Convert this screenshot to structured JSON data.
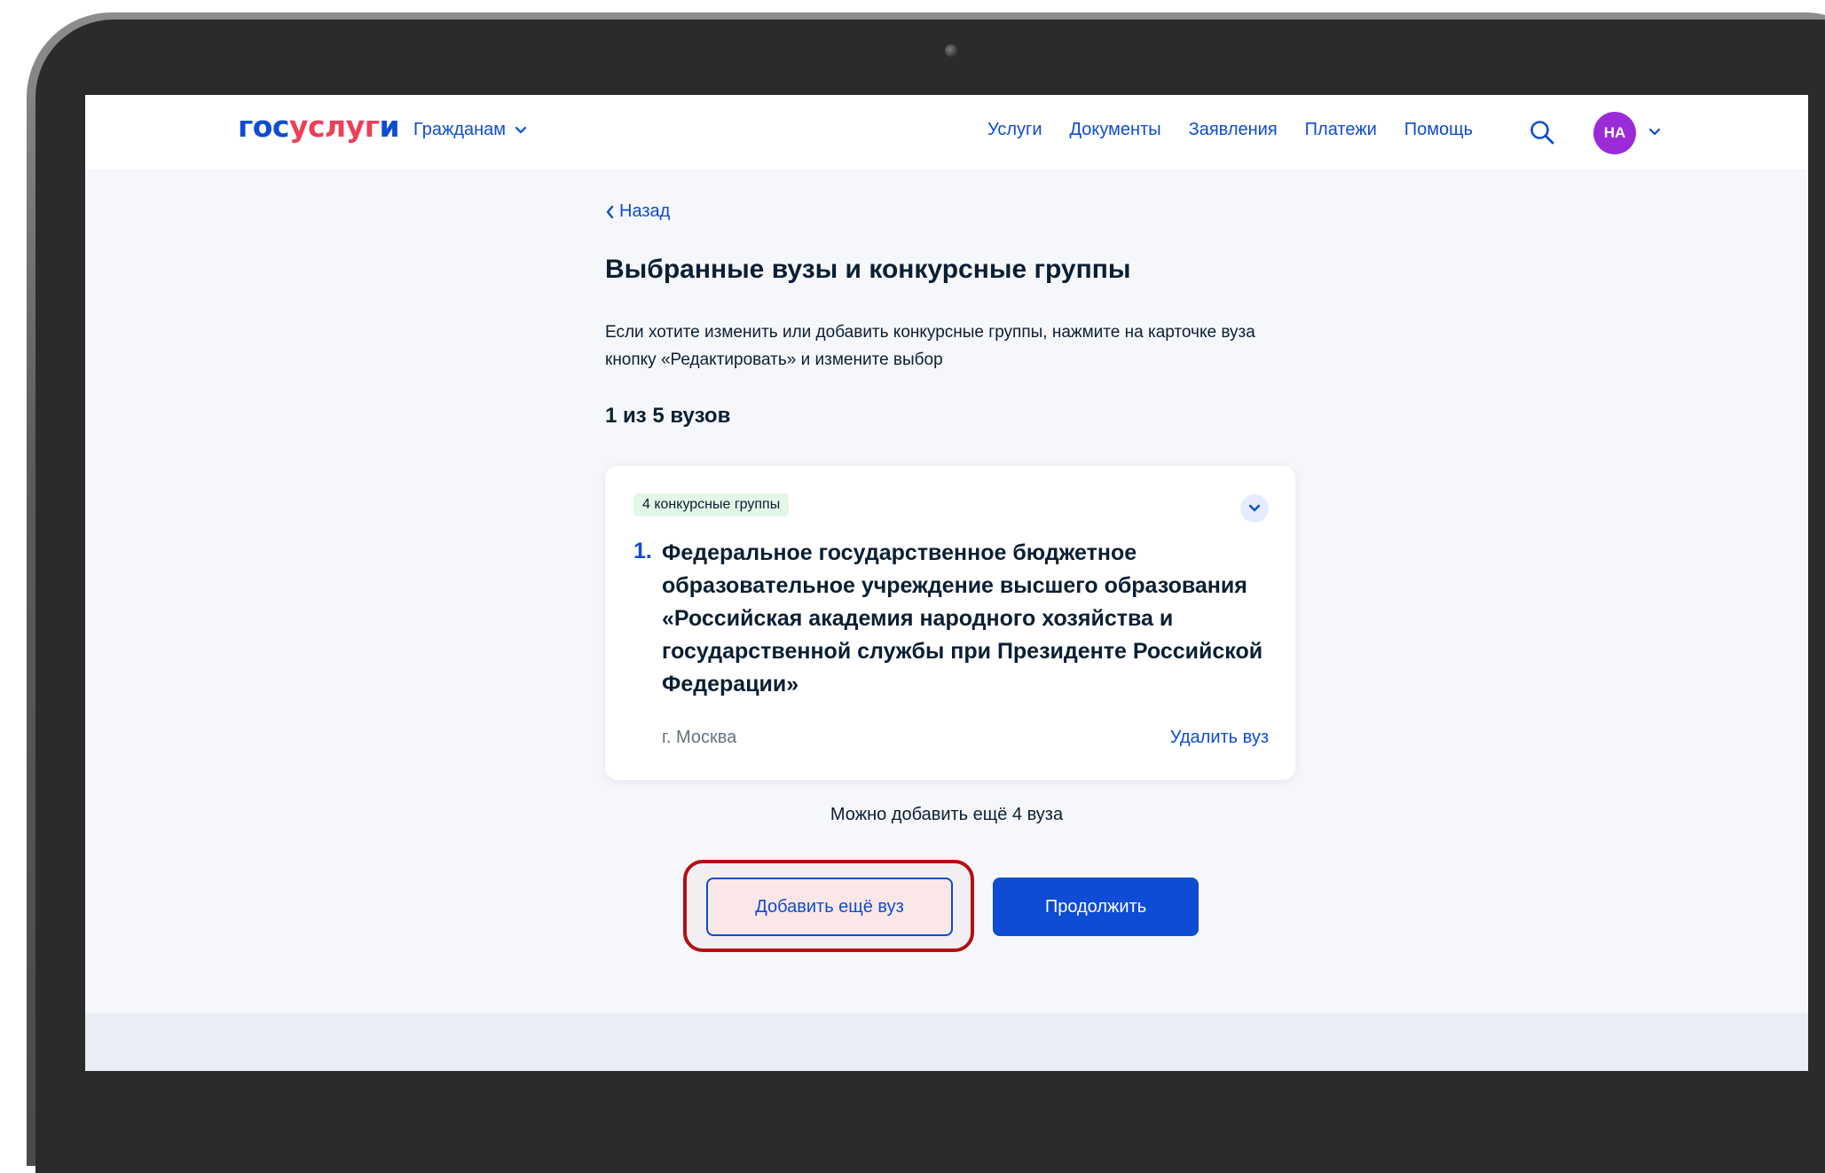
{
  "header": {
    "logo_part1": "гос",
    "logo_part2": "услуг",
    "logo_part3": "и",
    "citizens_label": "Гражданам",
    "nav": [
      "Услуги",
      "Документы",
      "Заявления",
      "Платежи",
      "Помощь"
    ],
    "avatar_initials": "НА"
  },
  "page": {
    "back_label": "Назад",
    "title": "Выбранные вузы и конкурсные группы",
    "description": "Если хотите изменить или добавить конкурсные группы, нажмите на карточке вуза кнопку «Редактировать» и измените выбор",
    "counter": "1 из 5 вузов"
  },
  "card": {
    "badge": "4 конкурсные группы",
    "number": "1.",
    "name": "Федеральное государственное бюджетное образовательное учреждение высшего образования «Российская академия народного хозяйства и государственной службы при Президенте Российской Федерации»",
    "city": "г. Москва",
    "delete_label": "Удалить вуз"
  },
  "actions": {
    "can_add_text": "Можно добавить ещё 4 вуза",
    "add_button": "Добавить ещё вуз",
    "continue_button": "Продолжить"
  },
  "colors": {
    "brand_blue": "#0d4cd3",
    "brand_red": "#ee3f58",
    "avatar": "#9b2bd8",
    "highlight_frame": "#b21014",
    "badge_bg": "#e3f7e8"
  },
  "icons": [
    "chevron-down-icon",
    "search-icon",
    "chevron-left-icon",
    "camera-icon"
  ]
}
